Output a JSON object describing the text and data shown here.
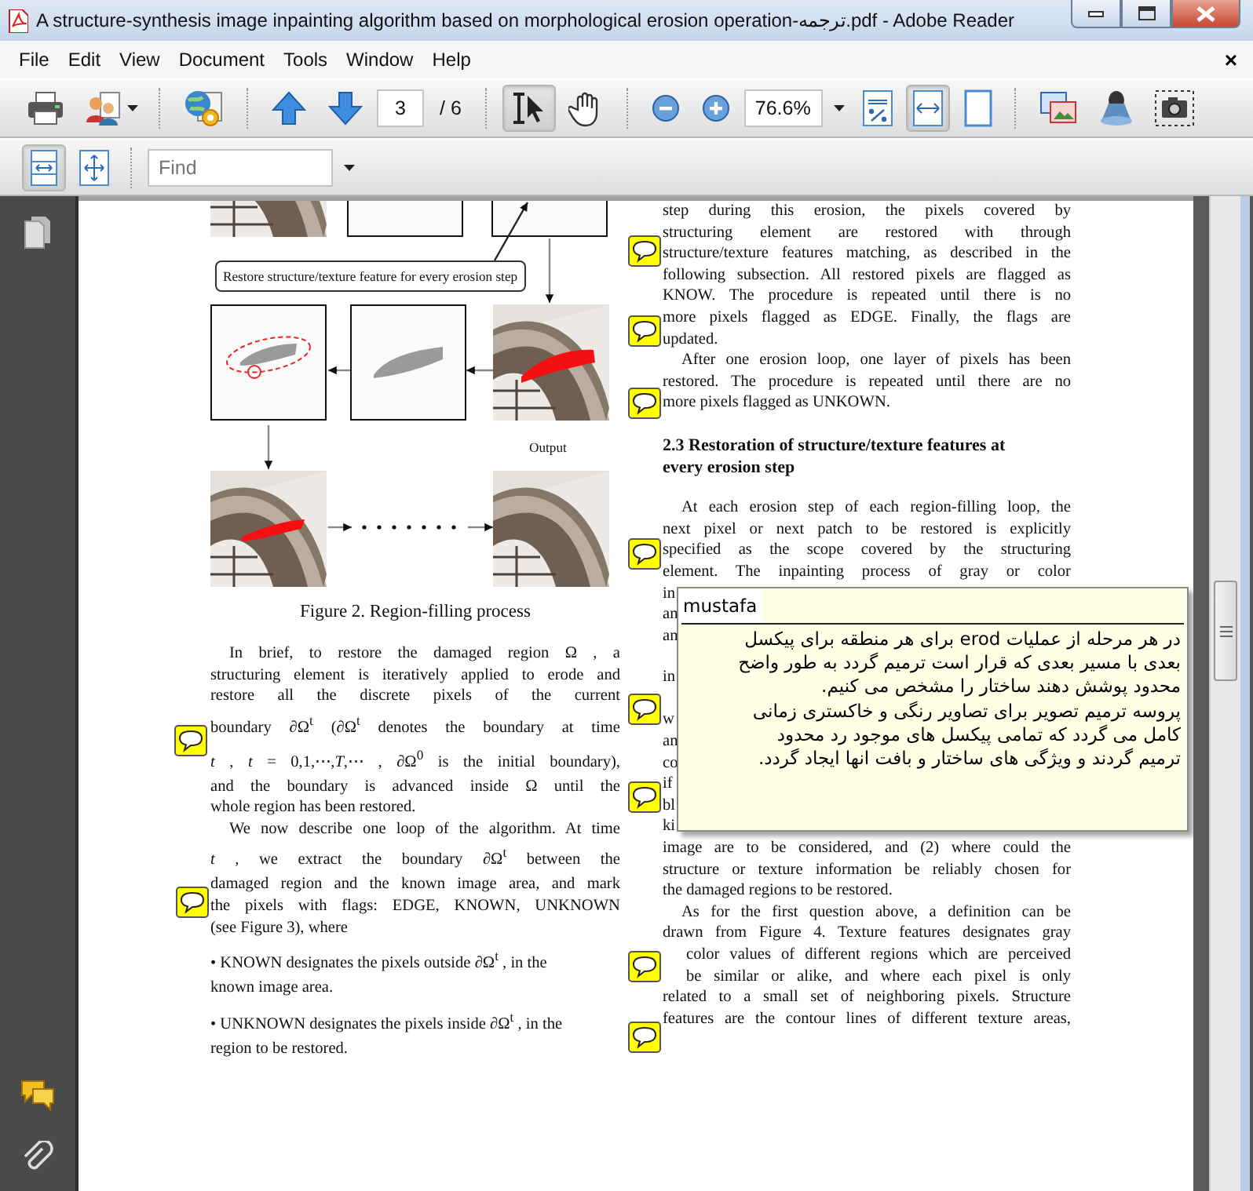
{
  "window": {
    "title": "A structure-synthesis image inpainting algorithm based on morphological erosion operation-ترجمه.pdf - Adobe Reader"
  },
  "menu": {
    "items": [
      "File",
      "Edit",
      "View",
      "Document",
      "Tools",
      "Window",
      "Help"
    ],
    "close": "×"
  },
  "toolbar": [
    {
      "kind": "print",
      "selected": false
    },
    {
      "kind": "share",
      "selected": false
    },
    {
      "kind": "sep"
    },
    {
      "kind": "globe",
      "selected": false
    },
    {
      "kind": "sep"
    },
    {
      "kind": "prev",
      "selected": false
    },
    {
      "kind": "next",
      "selected": false
    },
    {
      "kind": "page",
      "value": "3",
      "total": "/ 6"
    },
    {
      "kind": "sep"
    },
    {
      "kind": "select",
      "selected": true
    },
    {
      "kind": "hand",
      "selected": false
    },
    {
      "kind": "sep"
    },
    {
      "kind": "zoomout",
      "selected": false
    },
    {
      "kind": "zoomin",
      "selected": false
    },
    {
      "kind": "zoom",
      "value": "76.6%"
    },
    {
      "kind": "actual",
      "selected": false
    },
    {
      "kind": "fitwidth",
      "selected": true
    },
    {
      "kind": "fitpage",
      "selected": false
    },
    {
      "kind": "sep"
    },
    {
      "kind": "media",
      "selected": false
    },
    {
      "kind": "stamp",
      "selected": false
    },
    {
      "kind": "camera",
      "selected": false
    }
  ],
  "toolbar2": [
    {
      "kind": "single",
      "selected": true
    },
    {
      "kind": "fitvis",
      "selected": false
    },
    {
      "kind": "sep"
    },
    {
      "kind": "find",
      "placeholder": "Find"
    }
  ],
  "figure": {
    "callout": "Restore structure/texture feature for every erosion step",
    "output_label": "Output",
    "caption": "Figure 2. Region-filling process"
  },
  "left_column": [
    {
      "lines": [
        {
          "kind": "first",
          "text": "In brief, to restore the damaged region Ω , a"
        },
        {
          "kind": "full",
          "text": "structuring element is iteratively applied to erode and"
        },
        {
          "kind": "full",
          "text": "restore all the discrete pixels of the current"
        },
        {
          "kind": "full",
          "text": "boundary ∂Ω$^{t}$  (∂Ω$^{t}$  denotes the boundary at time"
        },
        {
          "kind": "full",
          "text": "*t* ,  *t* = 0,1,⋯,*T*,⋯ ,  ∂Ω$^{0}$ is the initial boundary),"
        },
        {
          "kind": "full",
          "text": "and the boundary is advanced inside Ω  until the"
        },
        {
          "kind": "end",
          "text": "whole region has been restored."
        },
        {
          "kind": "first",
          "text": "We now describe one loop of the algorithm. At time"
        },
        {
          "kind": "full",
          "text": "*t* , we extract the boundary  ∂Ω$^{t}$  between the"
        },
        {
          "kind": "full",
          "text": "damaged region and the known image area, and mark"
        },
        {
          "kind": "full",
          "text": "the pixels with flags: EDGE, KNOWN, UNKNOWN"
        },
        {
          "kind": "end",
          "text": "(see Figure 3), where"
        }
      ]
    },
    {
      "lines": [
        {
          "kind": "end",
          "text": "• KNOWN designates the pixels outside ∂Ω$^{t}$ , in the"
        },
        {
          "kind": "end",
          "text": "known image area."
        }
      ]
    },
    {
      "lines": [
        {
          "kind": "end",
          "text": "• UNKNOWN designates the pixels inside ∂Ω$^{t}$ , in the"
        },
        {
          "kind": "end",
          "text": "region to be restored."
        }
      ]
    }
  ],
  "right_column": [
    {
      "kind": "para",
      "lines": [
        {
          "kind": "full",
          "text": "step during this erosion, the pixels covered by"
        },
        {
          "kind": "full",
          "text": "structuring element are restored with through"
        },
        {
          "kind": "full",
          "text": "structure/texture features matching, as described in the"
        },
        {
          "kind": "full",
          "text": "following subsection. All restored pixels are flagged as"
        },
        {
          "kind": "full",
          "text": "KNOW. The procedure is repeated until there is no"
        },
        {
          "kind": "full",
          "text": "more pixels flagged as EDGE. Finally, the flags are"
        },
        {
          "kind": "end",
          "text": "updated."
        },
        {
          "kind": "first",
          "text": "After one erosion loop, one layer of pixels has been"
        },
        {
          "kind": "full",
          "text": "restored. The procedure is repeated until there are no"
        },
        {
          "kind": "end",
          "text": "more pixels flagged as UNKOWN."
        }
      ]
    },
    {
      "kind": "heading",
      "lines": [
        {
          "kind": "end",
          "text": "2.3 Restoration of structure/texture features at"
        },
        {
          "kind": "end",
          "text": "every erosion step"
        }
      ]
    },
    {
      "kind": "para",
      "lines": [
        {
          "kind": "first",
          "text": "At each erosion step of each region-filling loop, the"
        },
        {
          "kind": "full",
          "text": "next pixel or next patch to be restored is explicitly"
        },
        {
          "kind": "full",
          "text": "specified as the scope covered by the structuring"
        },
        {
          "kind": "full",
          "text": "element. The inpainting process of gray or color"
        },
        {
          "kind": "frag",
          "text": "in"
        },
        {
          "kind": "frag",
          "text": "an"
        },
        {
          "kind": "frag",
          "text": "an"
        }
      ]
    },
    {
      "kind": "para",
      "lines": [
        {
          "kind": "frag",
          "text": "in"
        },
        {
          "kind": "fragafter",
          "text": "w"
        },
        {
          "kind": "frag",
          "text": "an"
        },
        {
          "kind": "frag",
          "text": "co"
        },
        {
          "kind": "frag",
          "text": "if"
        },
        {
          "kind": "frag",
          "text": "bl"
        },
        {
          "kind": "frag",
          "text": "ki"
        },
        {
          "kind": "full",
          "text": "image are to be considered, and (2) where could the"
        },
        {
          "kind": "full",
          "text": "structure or texture information be reliably chosen for"
        },
        {
          "kind": "end",
          "text": "the damaged regions to be restored."
        },
        {
          "kind": "first",
          "text": "As for the first question above, a definition can be"
        },
        {
          "kind": "full",
          "text": "drawn from Figure 4. Texture features designates gray"
        },
        {
          "kind": "shifted",
          "text": "color values of different regions which are perceived"
        },
        {
          "kind": "shifted",
          "text": "be similar or alike, and where each pixel is only"
        },
        {
          "kind": "full",
          "text": "related to a small set of neighboring pixels. Structure"
        },
        {
          "kind": "full",
          "text": "features are the contour lines of different texture areas,"
        }
      ]
    }
  ],
  "note_popup": {
    "author": "mustafa",
    "lines": [
      "در هر مرحله از عملیات erod برای هر منطقه برای پیکسل",
      "بعدی با مسیر بعدی که قرار است ترمیم گردد به طور واضح",
      "محدود پوشش دهند ساختار را مشخص می کنیم.",
      "پروسه ترمیم تصویر برای تصاویر رنگی و خاکستری زمانی",
      "کامل می گردد  که تمامی پیکسل های موجود رد محدود",
      "ترمیم گردند و ویژگی های ساختار و بافت انها ایجاد گردد."
    ]
  }
}
